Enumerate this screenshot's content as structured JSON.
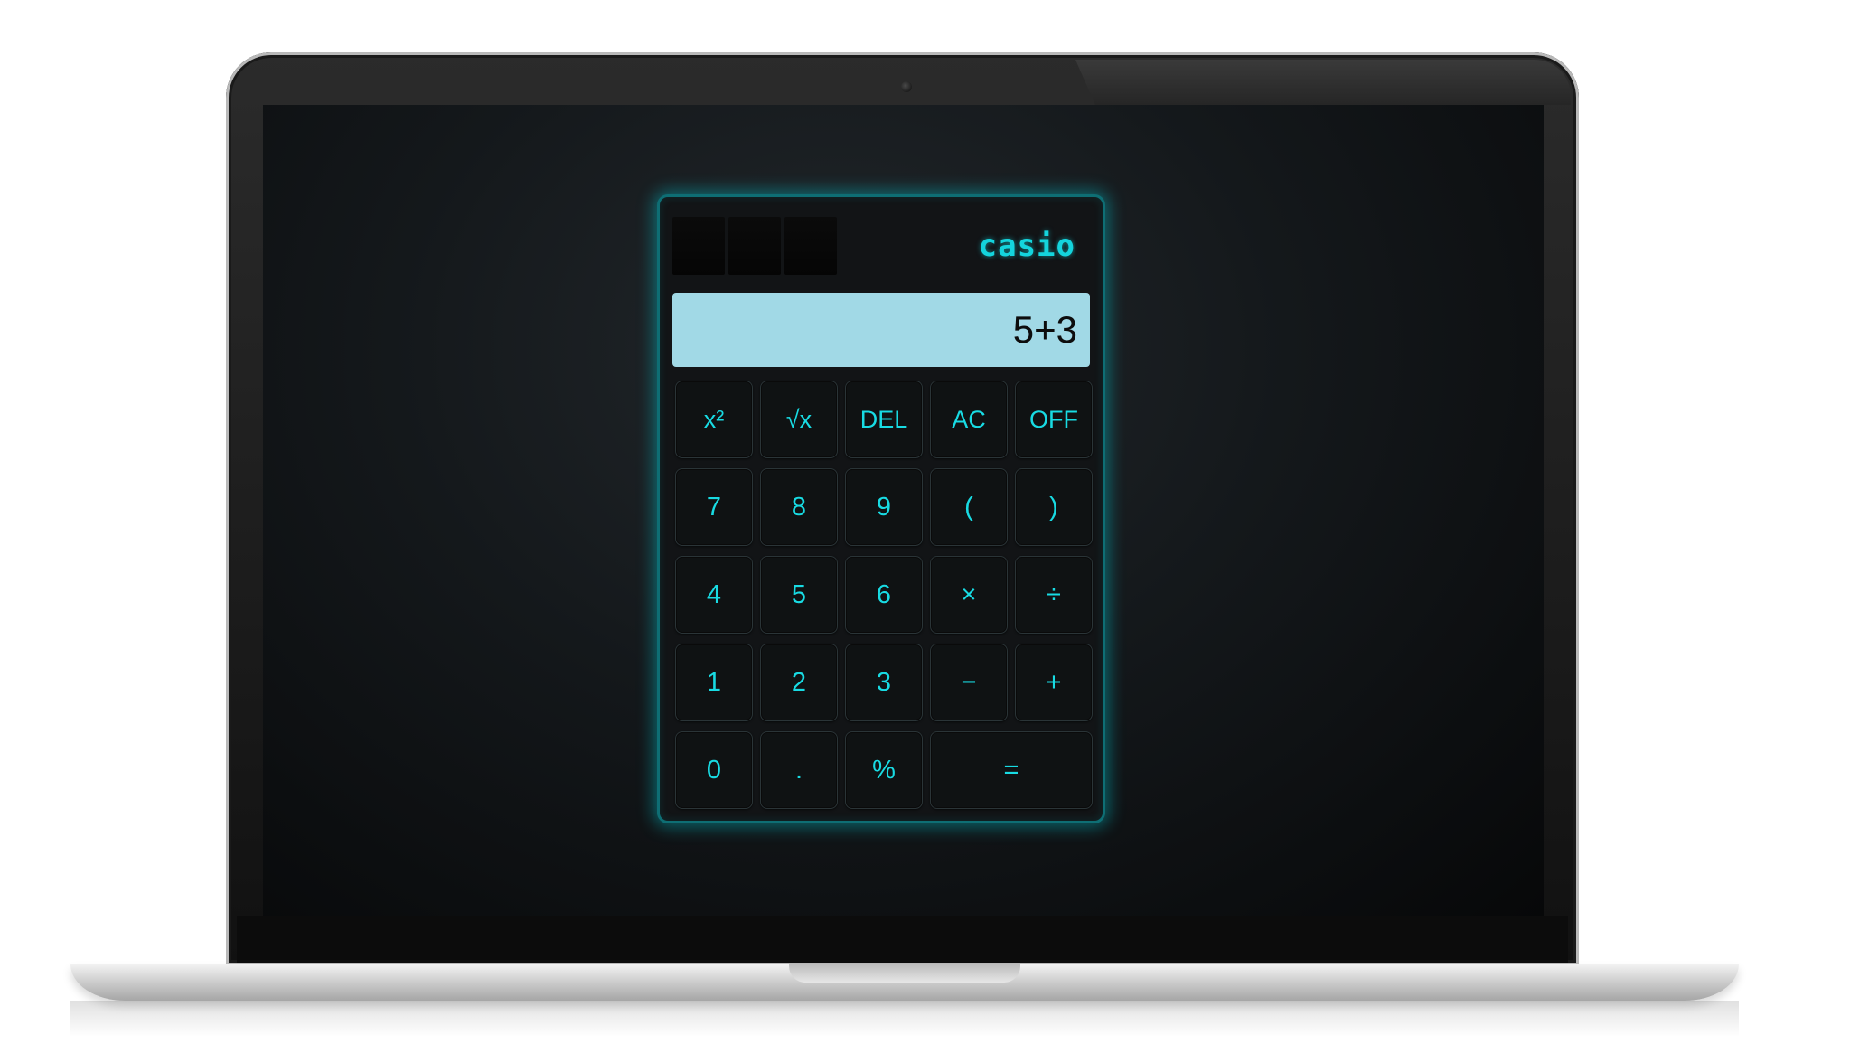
{
  "calculator": {
    "brand": "casio",
    "display": "5+3",
    "keys": [
      {
        "label": "x²",
        "name": "square-key"
      },
      {
        "label": "√x",
        "name": "sqrt-key"
      },
      {
        "label": "DEL",
        "name": "delete-key"
      },
      {
        "label": "AC",
        "name": "all-clear-key"
      },
      {
        "label": "OFF",
        "name": "off-key"
      },
      {
        "label": "7",
        "name": "digit-7-key"
      },
      {
        "label": "8",
        "name": "digit-8-key"
      },
      {
        "label": "9",
        "name": "digit-9-key"
      },
      {
        "label": "(",
        "name": "open-paren-key"
      },
      {
        "label": ")",
        "name": "close-paren-key"
      },
      {
        "label": "4",
        "name": "digit-4-key"
      },
      {
        "label": "5",
        "name": "digit-5-key"
      },
      {
        "label": "6",
        "name": "digit-6-key"
      },
      {
        "label": "×",
        "name": "multiply-key"
      },
      {
        "label": "÷",
        "name": "divide-key"
      },
      {
        "label": "1",
        "name": "digit-1-key"
      },
      {
        "label": "2",
        "name": "digit-2-key"
      },
      {
        "label": "3",
        "name": "digit-3-key"
      },
      {
        "label": "−",
        "name": "subtract-key"
      },
      {
        "label": "+",
        "name": "add-key"
      },
      {
        "label": "0",
        "name": "digit-0-key"
      },
      {
        "label": ".",
        "name": "decimal-key"
      },
      {
        "label": "%",
        "name": "percent-key"
      },
      {
        "label": "=",
        "name": "equals-key"
      }
    ]
  },
  "colors": {
    "accent": "#14d4dd",
    "display_bg": "#a1d9e6",
    "body": "#121416"
  }
}
